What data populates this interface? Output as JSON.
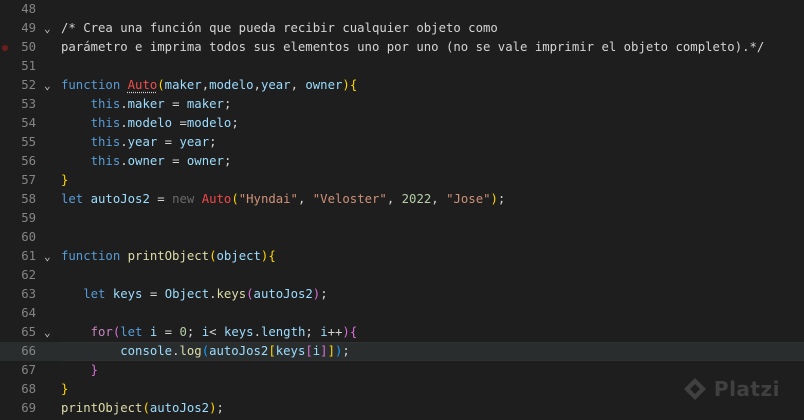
{
  "lines": [
    {
      "num": "48",
      "fold": "",
      "bp": false,
      "current": false,
      "tokens": []
    },
    {
      "num": "49",
      "fold": "⌄",
      "bp": false,
      "current": false,
      "tokens": [
        {
          "t": "/* Crea una función que pueda recibir cualquier objeto como",
          "c": "com"
        }
      ]
    },
    {
      "num": "50",
      "fold": "",
      "bp": true,
      "current": false,
      "tokens": [
        {
          "t": "parámetro e imprima todos sus elementos uno por uno (no se vale imprimir el objeto completo).*/",
          "c": "com"
        }
      ]
    },
    {
      "num": "51",
      "fold": "",
      "bp": false,
      "current": false,
      "tokens": []
    },
    {
      "num": "52",
      "fold": "⌄",
      "bp": false,
      "current": false,
      "tokens": [
        {
          "t": "function ",
          "c": "kw"
        },
        {
          "t": "Auto",
          "c": "fnerr"
        },
        {
          "t": "(",
          "c": "br1"
        },
        {
          "t": "maker",
          "c": "prm"
        },
        {
          "t": ",",
          "c": "op"
        },
        {
          "t": "modelo",
          "c": "prm"
        },
        {
          "t": ",",
          "c": "op"
        },
        {
          "t": "year",
          "c": "prm"
        },
        {
          "t": ", ",
          "c": "op"
        },
        {
          "t": "owner",
          "c": "prm"
        },
        {
          "t": ")",
          "c": "br1"
        },
        {
          "t": "{",
          "c": "br1"
        }
      ]
    },
    {
      "num": "53",
      "fold": "",
      "bp": false,
      "current": false,
      "tokens": [
        {
          "t": "    ",
          "c": "op"
        },
        {
          "t": "this",
          "c": "thisk"
        },
        {
          "t": ".",
          "c": "op"
        },
        {
          "t": "maker",
          "c": "var"
        },
        {
          "t": " = ",
          "c": "op"
        },
        {
          "t": "maker",
          "c": "var"
        },
        {
          "t": ";",
          "c": "op"
        }
      ]
    },
    {
      "num": "54",
      "fold": "",
      "bp": false,
      "current": false,
      "tokens": [
        {
          "t": "    ",
          "c": "op"
        },
        {
          "t": "this",
          "c": "thisk"
        },
        {
          "t": ".",
          "c": "op"
        },
        {
          "t": "modelo",
          "c": "var"
        },
        {
          "t": " =",
          "c": "op"
        },
        {
          "t": "modelo",
          "c": "var"
        },
        {
          "t": ";",
          "c": "op"
        }
      ]
    },
    {
      "num": "55",
      "fold": "",
      "bp": false,
      "current": false,
      "tokens": [
        {
          "t": "    ",
          "c": "op"
        },
        {
          "t": "this",
          "c": "thisk"
        },
        {
          "t": ".",
          "c": "op"
        },
        {
          "t": "year",
          "c": "var"
        },
        {
          "t": " = ",
          "c": "op"
        },
        {
          "t": "year",
          "c": "var"
        },
        {
          "t": ";",
          "c": "op"
        }
      ]
    },
    {
      "num": "56",
      "fold": "",
      "bp": false,
      "current": false,
      "tokens": [
        {
          "t": "    ",
          "c": "op"
        },
        {
          "t": "this",
          "c": "thisk"
        },
        {
          "t": ".",
          "c": "op"
        },
        {
          "t": "owner",
          "c": "var"
        },
        {
          "t": " = ",
          "c": "op"
        },
        {
          "t": "owner",
          "c": "var"
        },
        {
          "t": ";",
          "c": "op"
        }
      ]
    },
    {
      "num": "57",
      "fold": "",
      "bp": false,
      "current": false,
      "tokens": [
        {
          "t": "}",
          "c": "br1"
        }
      ]
    },
    {
      "num": "58",
      "fold": "",
      "bp": false,
      "current": false,
      "tokens": [
        {
          "t": "let ",
          "c": "kw"
        },
        {
          "t": "autoJos2",
          "c": "var"
        },
        {
          "t": " = ",
          "c": "op"
        },
        {
          "t": "new ",
          "c": "dim"
        },
        {
          "t": "Auto",
          "c": "cls"
        },
        {
          "t": "(",
          "c": "br1"
        },
        {
          "t": "\"Hyndai\"",
          "c": "str"
        },
        {
          "t": ", ",
          "c": "op"
        },
        {
          "t": "\"Veloster\"",
          "c": "str"
        },
        {
          "t": ", ",
          "c": "op"
        },
        {
          "t": "2022",
          "c": "num"
        },
        {
          "t": ", ",
          "c": "op"
        },
        {
          "t": "\"Jose\"",
          "c": "str"
        },
        {
          "t": ")",
          "c": "br1"
        },
        {
          "t": ";",
          "c": "op"
        }
      ]
    },
    {
      "num": "59",
      "fold": "",
      "bp": false,
      "current": false,
      "tokens": []
    },
    {
      "num": "60",
      "fold": "",
      "bp": false,
      "current": false,
      "tokens": []
    },
    {
      "num": "61",
      "fold": "⌄",
      "bp": false,
      "current": false,
      "tokens": [
        {
          "t": "function ",
          "c": "kw"
        },
        {
          "t": "printObject",
          "c": "fn"
        },
        {
          "t": "(",
          "c": "br1"
        },
        {
          "t": "object",
          "c": "prm"
        },
        {
          "t": ")",
          "c": "br1"
        },
        {
          "t": "{",
          "c": "br1"
        }
      ]
    },
    {
      "num": "62",
      "fold": "",
      "bp": false,
      "current": false,
      "tokens": []
    },
    {
      "num": "63",
      "fold": "",
      "bp": false,
      "current": false,
      "tokens": [
        {
          "t": "   ",
          "c": "op"
        },
        {
          "t": "let ",
          "c": "kw"
        },
        {
          "t": "keys",
          "c": "var"
        },
        {
          "t": " = ",
          "c": "op"
        },
        {
          "t": "Object",
          "c": "var"
        },
        {
          "t": ".",
          "c": "op"
        },
        {
          "t": "keys",
          "c": "fn"
        },
        {
          "t": "(",
          "c": "br2"
        },
        {
          "t": "autoJos2",
          "c": "var"
        },
        {
          "t": ")",
          "c": "br2"
        },
        {
          "t": ";",
          "c": "op"
        }
      ]
    },
    {
      "num": "64",
      "fold": "",
      "bp": false,
      "current": false,
      "tokens": []
    },
    {
      "num": "65",
      "fold": "⌄",
      "bp": false,
      "current": false,
      "tokens": [
        {
          "t": "    ",
          "c": "op"
        },
        {
          "t": "for",
          "c": "ctl"
        },
        {
          "t": "(",
          "c": "br2"
        },
        {
          "t": "let ",
          "c": "kw"
        },
        {
          "t": "i",
          "c": "var"
        },
        {
          "t": " = ",
          "c": "op"
        },
        {
          "t": "0",
          "c": "num"
        },
        {
          "t": "; ",
          "c": "op"
        },
        {
          "t": "i",
          "c": "var"
        },
        {
          "t": "< ",
          "c": "op"
        },
        {
          "t": "keys",
          "c": "var"
        },
        {
          "t": ".",
          "c": "op"
        },
        {
          "t": "length",
          "c": "var"
        },
        {
          "t": "; ",
          "c": "op"
        },
        {
          "t": "i",
          "c": "var"
        },
        {
          "t": "++",
          "c": "op"
        },
        {
          "t": ")",
          "c": "br2"
        },
        {
          "t": "{",
          "c": "br2"
        }
      ]
    },
    {
      "num": "66",
      "fold": "",
      "bp": false,
      "current": true,
      "tokens": [
        {
          "t": "        ",
          "c": "op"
        },
        {
          "t": "console",
          "c": "var"
        },
        {
          "t": ".",
          "c": "op"
        },
        {
          "t": "log",
          "c": "fn"
        },
        {
          "t": "(",
          "c": "br3"
        },
        {
          "t": "autoJos2",
          "c": "var"
        },
        {
          "t": "[",
          "c": "br1"
        },
        {
          "t": "keys",
          "c": "var"
        },
        {
          "t": "[",
          "c": "br2"
        },
        {
          "t": "i",
          "c": "var"
        },
        {
          "t": "]",
          "c": "br2"
        },
        {
          "t": "]",
          "c": "br1"
        },
        {
          "t": ")",
          "c": "br3"
        },
        {
          "t": ";",
          "c": "op"
        }
      ]
    },
    {
      "num": "67",
      "fold": "",
      "bp": false,
      "current": false,
      "tokens": [
        {
          "t": "    ",
          "c": "op"
        },
        {
          "t": "}",
          "c": "br2"
        }
      ]
    },
    {
      "num": "68",
      "fold": "",
      "bp": false,
      "current": false,
      "tokens": [
        {
          "t": "}",
          "c": "br1"
        }
      ]
    },
    {
      "num": "69",
      "fold": "",
      "bp": false,
      "current": false,
      "tokens": [
        {
          "t": "printObject",
          "c": "fn"
        },
        {
          "t": "(",
          "c": "br1"
        },
        {
          "t": "autoJos2",
          "c": "var"
        },
        {
          "t": ")",
          "c": "br1"
        },
        {
          "t": ";",
          "c": "op"
        }
      ]
    }
  ],
  "watermark": {
    "text": "Platzi",
    "icon": "platzi-logo-icon"
  }
}
